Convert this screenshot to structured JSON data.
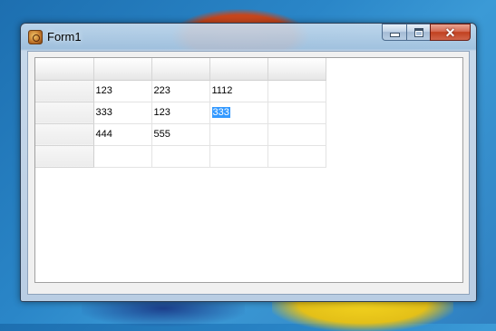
{
  "window": {
    "title": "Form1",
    "icon": "app-icon"
  },
  "caption_buttons": {
    "minimize_icon": "minimize-icon",
    "maximize_icon": "maximize-icon",
    "close_icon": "close-icon",
    "close_glyph": "✕"
  },
  "grid": {
    "column_headers": [
      "",
      "",
      "",
      ""
    ],
    "rows": [
      {
        "header": "",
        "cells": [
          "123",
          "223",
          "1112",
          ""
        ]
      },
      {
        "header": "",
        "cells": [
          "333",
          "123",
          "333",
          ""
        ]
      },
      {
        "header": "",
        "cells": [
          "444",
          "555",
          "",
          ""
        ]
      },
      {
        "header": "",
        "cells": [
          "",
          "",
          "",
          ""
        ]
      }
    ],
    "selected_cell": {
      "row": 2,
      "col": 3
    }
  }
}
